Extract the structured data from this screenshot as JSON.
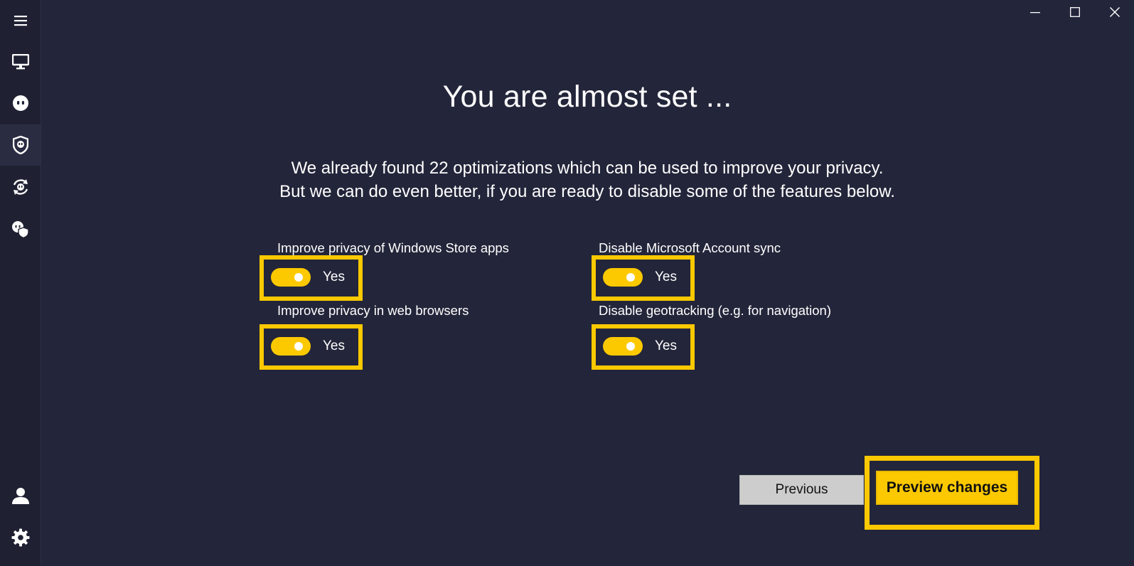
{
  "window": {
    "controls": [
      "minimize",
      "maximize",
      "close"
    ]
  },
  "sidebar": {
    "items": [
      {
        "icon": "menu-icon",
        "active": false
      },
      {
        "icon": "monitor-icon",
        "active": false
      },
      {
        "icon": "ghost-icon",
        "active": false
      },
      {
        "icon": "shield-icon",
        "active": true
      },
      {
        "icon": "refresh-icon",
        "active": false
      },
      {
        "icon": "ghost-shield-icon",
        "active": false
      }
    ],
    "bottom_items": [
      {
        "icon": "user-icon"
      },
      {
        "icon": "gear-icon"
      }
    ]
  },
  "main": {
    "title": "You are almost set ...",
    "description_line1": "We already found 22 optimizations which can be used to improve your privacy.",
    "description_line2": "But we can do even better, if you are ready to disable some of the features below.",
    "options": [
      {
        "label": "Improve privacy of Windows Store apps",
        "state": "Yes",
        "on": true
      },
      {
        "label": "Disable Microsoft Account sync",
        "state": "Yes",
        "on": true
      },
      {
        "label": "Improve privacy in web browsers",
        "state": "Yes",
        "on": true
      },
      {
        "label": "Disable geotracking (e.g. for navigation)",
        "state": "Yes",
        "on": true
      }
    ]
  },
  "buttons": {
    "previous": "Previous",
    "preview": "Preview changes"
  },
  "colors": {
    "background": "#23253a",
    "sidebar": "#1f2133",
    "accent": "#fcc900"
  }
}
